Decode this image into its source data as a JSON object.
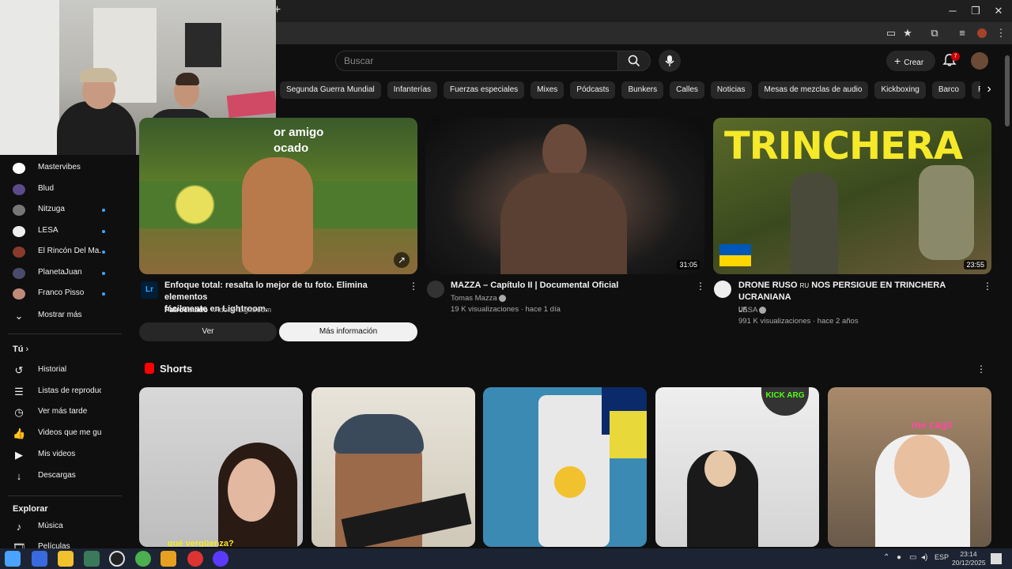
{
  "browser": {
    "new_tab": "+",
    "win_min": "─",
    "win_max": "❐",
    "win_close": "✕"
  },
  "header": {
    "search_placeholder": "Buscar",
    "create_label": "Crear",
    "notif_count": "7"
  },
  "chips": [
    "Segunda Guerra Mundial",
    "Infanterías",
    "Fuerzas especiales",
    "Mixes",
    "Pódcasts",
    "Bunkers",
    "Calles",
    "Noticias",
    "Mesas de mezclas de audio",
    "Kickboxing",
    "Barco",
    "Reggae"
  ],
  "sidebar": {
    "subscriptions": [
      {
        "label": "Mastervibes",
        "color": "#ffffff",
        "dot": false
      },
      {
        "label": "Blud",
        "color": "#5b4b8a",
        "dot": false
      },
      {
        "label": "Nitzuga",
        "color": "#777777",
        "dot": true
      },
      {
        "label": "LESA",
        "color": "#eeeeee",
        "dot": true
      },
      {
        "label": "El Rincón Del Ma...",
        "color": "#8a3a2a",
        "dot": true
      },
      {
        "label": "PlanetaJuan",
        "color": "#4a4a6a",
        "dot": true
      },
      {
        "label": "Franco Pisso",
        "color": "#c08a7a",
        "dot": true
      }
    ],
    "show_more": "Mostrar más",
    "you_heading": "Tú",
    "you_items": [
      "Historial",
      "Listas de reproducc...",
      "Ver más tarde",
      "Videos que me gust...",
      "Mis videos",
      "Descargas"
    ],
    "explore_heading": "Explorar",
    "explore_items": [
      "Música",
      "Películas"
    ]
  },
  "videos": [
    {
      "title_line1": "Enfoque total: resalta lo mejor de tu foto. Elimina elementos",
      "title_line2": "fácilmente en Lightroom.",
      "sponsored": "Patrocinado",
      "advertiser": "· Adobe Lightroom",
      "thumb_text_1": "or amigo",
      "thumb_text_2": "ocado",
      "avatar_text": "Lr",
      "btn_watch": "Ver",
      "btn_more": "Más información"
    },
    {
      "title": "MAZZA – Capítulo II | Documental Oficial",
      "channel": "Tomas Mazza",
      "meta": "19 K visualizaciones · hace 1 día",
      "duration": "31:05"
    },
    {
      "title": "DRONE RUSO",
      "title_flag": "RU",
      "title_rest": "NOS PERSIGUE EN TRINCHERA UCRANIANA",
      "title_line2": "UA",
      "channel": "LESA",
      "meta": "991 K visualizaciones · hace 2 años",
      "duration": "23:55",
      "thumb_text": "TRINCHERA"
    }
  ],
  "shorts": {
    "heading": "Shorts",
    "caption_1": "qué vergüenza?",
    "caption_4": "KICK ARG",
    "caption_5": "me cag#"
  },
  "taskbar": {
    "lang": "ESP",
    "time": "23:14",
    "date": "20/12/2025"
  },
  "colors": {
    "accent": "#3ea6ff",
    "youtube_red": "#ff0000",
    "background": "#0f0f0f"
  }
}
